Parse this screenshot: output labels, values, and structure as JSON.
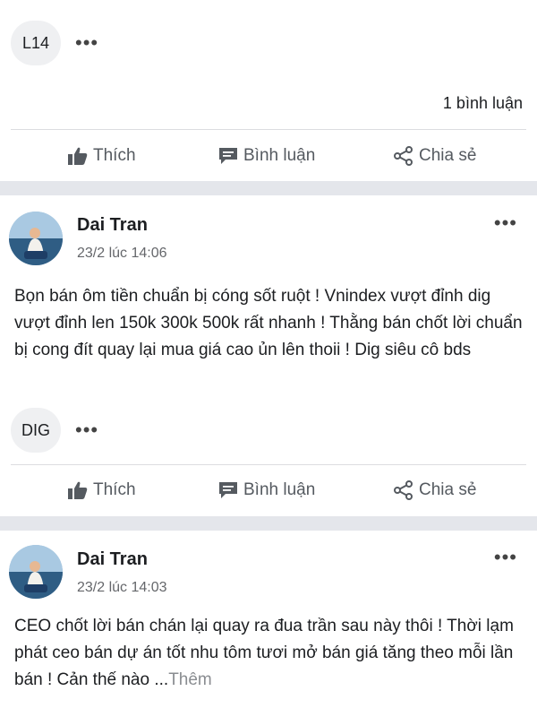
{
  "posts": [
    {
      "tag": "L14",
      "comment_count": "1 bình luận",
      "actions": {
        "like": "Thích",
        "comment": "Bình luận",
        "share": "Chia sẻ"
      }
    },
    {
      "author": "Dai Tran",
      "timestamp": "23/2 lúc 14:06",
      "text": "Bọn bán ôm tiền chuẩn bị cóng sốt ruột ! Vnindex vượt đỉnh dig vượt đỉnh len 150k 300k 500k rất nhanh ! Thằng bán chốt lời chuẩn bị cong đít quay lại mua giá cao ủn lên thoii ! Dig siêu cô bds",
      "tag": "DIG",
      "actions": {
        "like": "Thích",
        "comment": "Bình luận",
        "share": "Chia sẻ"
      }
    },
    {
      "author": "Dai Tran",
      "timestamp": "23/2 lúc 14:03",
      "text": "CEO chốt lời bán chán lại quay ra đua trần sau này thôi ! Thời lạm phát ceo bán dự án tốt nhu tôm tươi mở bán giá tăng theo mỗi lần bán ! Cản thế nào ...",
      "see_more": "Thêm"
    }
  ],
  "icons": {
    "more": "more-dots-icon",
    "like": "thumbs-up-icon",
    "comment": "comment-icon",
    "share": "share-icon"
  },
  "colors": {
    "separator": "#e4e6eb",
    "action_text": "#555a60",
    "meta_text": "#65676b"
  }
}
